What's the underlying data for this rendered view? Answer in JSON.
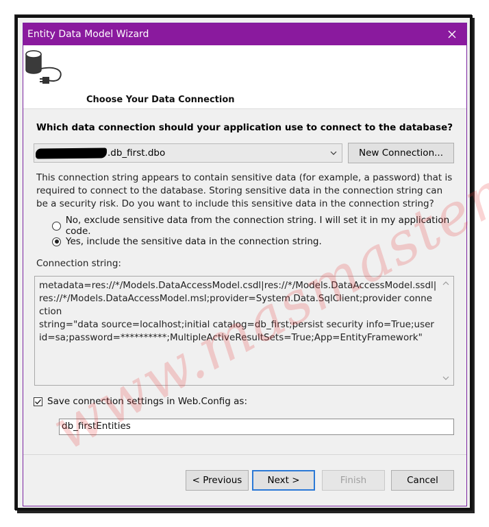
{
  "window": {
    "title": "Entity Data Model Wizard",
    "close_icon": "close-icon"
  },
  "header": {
    "title": "Choose Your Data Connection",
    "icon": "database-connection-icon"
  },
  "main": {
    "question": "Which data connection should your application use to connect to the database?",
    "connection_select": {
      "selected_value": ".db_first.dbo"
    },
    "new_connection_label": "New Connection...",
    "warning_text": "This connection string appears to contain sensitive data (for example, a password) that is required to connect to the database. Storing sensitive data in the connection string can be a security risk. Do you want to include this sensitive data in the connection string?",
    "radio_options": [
      {
        "label": "No, exclude sensitive data from the connection string. I will set it in my application code.",
        "checked": false
      },
      {
        "label": "Yes, include the sensitive data in the connection string.",
        "checked": true
      }
    ],
    "connection_string_label": "Connection string:",
    "connection_string": "metadata=res://*/Models.DataAccessModel.csdl|res://*/Models.DataAccessModel.ssdl|\nres://*/Models.DataAccessModel.msl;provider=System.Data.SqlClient;provider connection\nstring=\"data source=localhost;initial catalog=db_first;persist security info=True;user\nid=sa;password=**********;MultipleActiveResultSets=True;App=EntityFramework\"",
    "save_settings": {
      "label": "Save connection settings in Web.Config as:",
      "checked": true
    },
    "entities_name": "db_firstEntities"
  },
  "footer": {
    "previous_label": "< Previous",
    "next_label": "Next >",
    "finish_label": "Finish",
    "cancel_label": "Cancel"
  },
  "watermark": "www.masmaster.com",
  "colors": {
    "titlebar": "#8a1a9e",
    "accent": "#2a78d6",
    "watermark": "#e63c3c"
  }
}
